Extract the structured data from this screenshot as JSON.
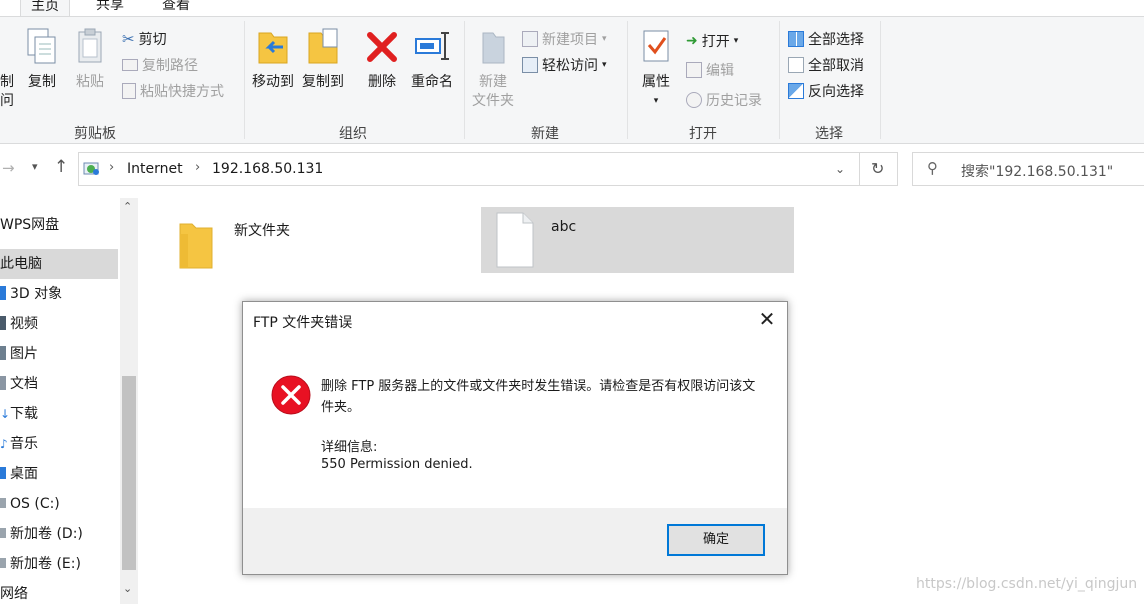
{
  "ribbon_tabs": [
    "主页",
    "共享",
    "查看"
  ],
  "clipboard": {
    "partial_label_line1": "制",
    "partial_label_line2": "问",
    "copy": "复制",
    "paste": "粘贴",
    "cut": "剪切",
    "copy_path": "复制路径",
    "paste_shortcut": "粘贴快捷方式",
    "group": "剪贴板"
  },
  "organize": {
    "move_to": "移动到",
    "copy_to": "复制到",
    "delete": "删除",
    "rename": "重命名",
    "group": "组织"
  },
  "new": {
    "new_folder_line1": "新建",
    "new_folder_line2": "文件夹",
    "new_item": "新建项目",
    "easy_access": "轻松访问",
    "group": "新建"
  },
  "open": {
    "properties": "属性",
    "open": "打开",
    "edit": "编辑",
    "history": "历史记录",
    "group": "打开"
  },
  "select": {
    "select_all": "全部选择",
    "select_none": "全部取消",
    "invert": "反向选择",
    "group": "选择"
  },
  "address": {
    "crumbs": [
      "Internet",
      "192.168.50.131"
    ],
    "search_placeholder": "搜索\"192.168.50.131\""
  },
  "nav_items": [
    "WPS网盘",
    "此电脑",
    "3D 对象",
    "视频",
    "图片",
    "文档",
    "下载",
    "音乐",
    "桌面",
    "OS (C:)",
    "新加卷 (D:)",
    "新加卷 (E:)",
    "网络"
  ],
  "files": [
    {
      "name": "新文件夹",
      "type": "folder"
    },
    {
      "name": "abc",
      "type": "file"
    }
  ],
  "dialog": {
    "title": "FTP 文件夹错误",
    "message": "删除 FTP 服务器上的文件或文件夹时发生错误。请检查是否有权限访问该文件夹。",
    "detail_label": "详细信息:",
    "detail_text": "550 Permission denied.",
    "ok": "确定"
  },
  "watermark": "https://blog.csdn.net/yi_qingjun",
  "colors": {
    "ribbon_bg": "#f5f6f7",
    "selection": "#d9d9d9",
    "error_red": "#e81123",
    "accent": "#0078d7"
  }
}
